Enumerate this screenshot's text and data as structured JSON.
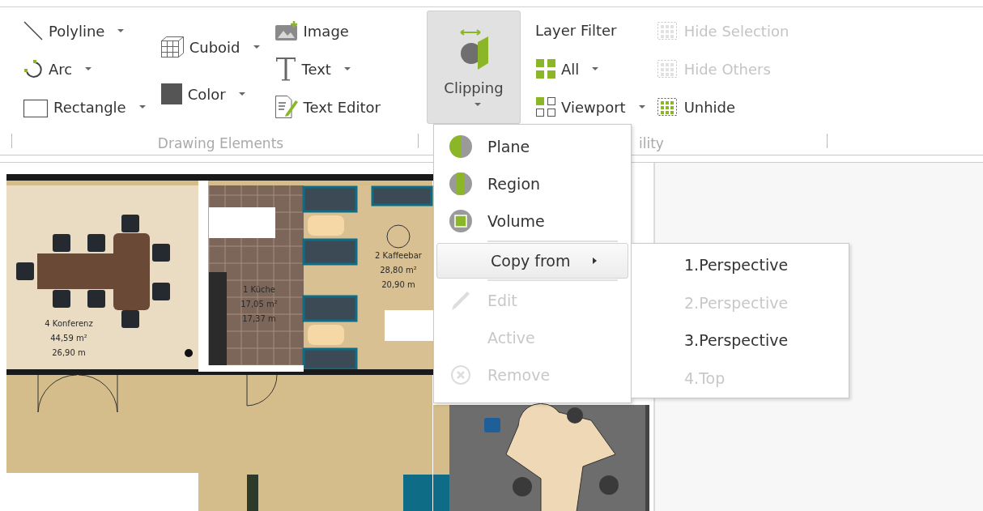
{
  "ribbon": {
    "drawing_elements": {
      "label": "Drawing Elements",
      "columns": [
        [
          {
            "label": "Polyline",
            "dropdown": true
          },
          {
            "label": "Arc",
            "dropdown": true
          },
          {
            "label": "Rectangle",
            "dropdown": true
          }
        ],
        [
          {
            "label": "Cuboid",
            "dropdown": true
          },
          {
            "label": "Color",
            "dropdown": true
          }
        ],
        [
          {
            "label": "Image",
            "dropdown": false
          },
          {
            "label": "Text",
            "dropdown": true
          },
          {
            "label": "Text Editor",
            "dropdown": false
          }
        ]
      ]
    },
    "clipping": {
      "label": "Clipping",
      "pressed": true
    },
    "visibility": {
      "label": "ility",
      "layer_filter": "Layer Filter",
      "filters": [
        {
          "label": "All",
          "dropdown": true
        },
        {
          "label": "Viewport",
          "dropdown": true
        }
      ],
      "hide": [
        {
          "label": "Hide Selection",
          "disabled": true
        },
        {
          "label": "Hide Others",
          "disabled": true
        },
        {
          "label": "Unhide",
          "disabled": false
        }
      ]
    }
  },
  "plan": {
    "rooms": [
      {
        "kind": "conference",
        "lines": [
          "4 Konferenz",
          "44,59 m²",
          "26,90 m"
        ]
      },
      {
        "kind": "kitchen",
        "lines": [
          "1 Küche",
          "17,05 m²",
          "17,37 m"
        ]
      },
      {
        "kind": "coffee",
        "lines": [
          "2 Kaffeebar",
          "28,80 m²",
          "20,90 m"
        ]
      }
    ]
  },
  "clipping_menu": {
    "items": [
      {
        "kind": "item",
        "label": "Plane",
        "disabled": false,
        "highlighted": false
      },
      {
        "kind": "item",
        "label": "Region",
        "disabled": false,
        "highlighted": false
      },
      {
        "kind": "item",
        "label": "Volume",
        "disabled": false,
        "highlighted": false
      },
      {
        "kind": "separator"
      },
      {
        "kind": "submenu",
        "label": "Copy from",
        "disabled": false,
        "highlighted": true
      },
      {
        "kind": "separator"
      },
      {
        "kind": "item",
        "label": "Edit",
        "disabled": true,
        "highlighted": false
      },
      {
        "kind": "item",
        "label": "Active",
        "disabled": true,
        "highlighted": false
      },
      {
        "kind": "item",
        "label": "Remove",
        "disabled": true,
        "highlighted": false
      }
    ],
    "submenu": [
      {
        "label": "1.Perspective",
        "disabled": false
      },
      {
        "label": "2.Perspective",
        "disabled": true
      },
      {
        "label": "3.Perspective",
        "disabled": false
      },
      {
        "label": "4.Top",
        "disabled": true
      }
    ]
  }
}
